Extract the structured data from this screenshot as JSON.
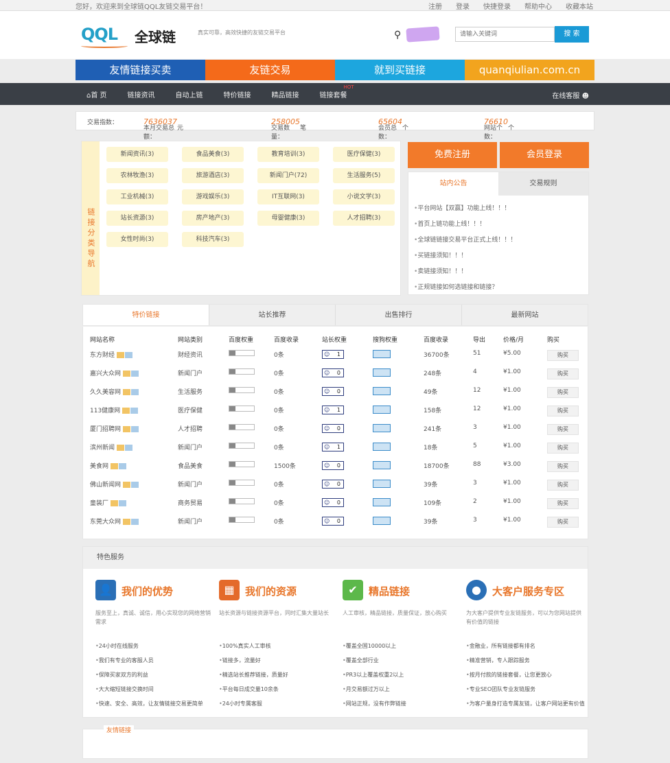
{
  "topbar": {
    "welcome": "您好，欢迎来到全球链QQL友链交易平台！",
    "links": [
      "注册",
      "登录",
      "快捷登录",
      "帮助中心",
      "收藏本站"
    ]
  },
  "header": {
    "logo_text": "QQL",
    "logo_cn": "全球链",
    "slogan": "真实可靠，高效快捷的友链交易平台",
    "search_placeholder": "请输入关键词",
    "search_button": "搜 索"
  },
  "banner": [
    {
      "label": "友情链接买卖",
      "color": "#1f5fb4"
    },
    {
      "label": "友链交易",
      "color": "#f46a1a"
    },
    {
      "label": "就到买链接",
      "color": "#1da6de"
    },
    {
      "label": "quanqiulian.com.cn",
      "color": "#f2a41e"
    }
  ],
  "nav": {
    "items": [
      "首 页",
      "链接资讯",
      "自动上链",
      "特价链接",
      "精品链接",
      "链接套餐"
    ],
    "hot": "HOT",
    "service": "在线客服"
  },
  "stats": {
    "label": "交易指数：",
    "amount_label": "本月交易总额：",
    "amount": "7636037",
    "amount_unit": "元",
    "count_label": "交易数量：",
    "count": "258005",
    "count_unit": "笔",
    "members_label": "会员总数：",
    "members": "65604",
    "members_unit": "个",
    "sites_label": "网站个数：",
    "sites": "76610",
    "sites_unit": "个"
  },
  "categories": {
    "side_label": "链接分类导航",
    "items": [
      "新闻资讯(3)",
      "食品美食(3)",
      "教育培训(3)",
      "医疗保健(3)",
      "农林牧渔(3)",
      "旅游酒店(3)",
      "新闻门户(72)",
      "生活服务(5)",
      "工业机械(3)",
      "游戏娱乐(3)",
      "IT互联网(3)",
      "小说文学(3)",
      "站长资源(3)",
      "房产地产(3)",
      "母婴健康(3)",
      "人才招聘(3)",
      "女性时尚(3)",
      "科技汽车(3)"
    ]
  },
  "register": {
    "free": "免费注册",
    "login": "会员登录"
  },
  "notice": {
    "tabs": [
      "站内公告",
      "交易规则"
    ],
    "items": [
      "平台网站【双赢】功能上线！！！",
      "首页上链功能上线！！！",
      "全球链链接交易平台正式上线！！！",
      "买链接须知！！！",
      "卖链接须知！！！",
      "正规链接如何选链接和链接？"
    ]
  },
  "table": {
    "tabs": [
      "特价链接",
      "站长推荐",
      "出售排行",
      "最新网站"
    ],
    "headers": [
      "网站名称",
      "网站类别",
      "百度权重",
      "百度收录",
      "站长权重",
      "搜狗权重",
      "百度收录",
      "导出",
      "价格/月",
      "购买"
    ],
    "rows": [
      {
        "name": "东方财经",
        "cat": "财经资讯",
        "idx": "0条",
        "pr": "1",
        "baidu": "36700条",
        "out": "51",
        "price": "¥5.00"
      },
      {
        "name": "嘉兴大众网",
        "cat": "新闻门户",
        "idx": "0条",
        "pr": "0",
        "baidu": "248条",
        "out": "4",
        "price": "¥1.00"
      },
      {
        "name": "久久美容网",
        "cat": "生活服务",
        "idx": "0条",
        "pr": "0",
        "baidu": "49条",
        "out": "12",
        "price": "¥1.00"
      },
      {
        "name": "113健康网",
        "cat": "医疗保健",
        "idx": "0条",
        "pr": "1",
        "baidu": "158条",
        "out": "12",
        "price": "¥1.00"
      },
      {
        "name": "厦门招聘网",
        "cat": "人才招聘",
        "idx": "0条",
        "pr": "0",
        "baidu": "241条",
        "out": "3",
        "price": "¥1.00"
      },
      {
        "name": "滨州新闻",
        "cat": "新闻门户",
        "idx": "0条",
        "pr": "1",
        "baidu": "18条",
        "out": "5",
        "price": "¥1.00"
      },
      {
        "name": "美食网",
        "cat": "食品美食",
        "idx": "1500条",
        "pr": "0",
        "baidu": "18700条",
        "out": "88",
        "price": "¥3.00"
      },
      {
        "name": "佛山新闻网",
        "cat": "新闻门户",
        "idx": "0条",
        "pr": "0",
        "baidu": "39条",
        "out": "3",
        "price": "¥1.00"
      },
      {
        "name": "童装厂",
        "cat": "商务贸易",
        "idx": "0条",
        "pr": "0",
        "baidu": "109条",
        "out": "2",
        "price": "¥1.00"
      },
      {
        "name": "东莞大众网",
        "cat": "新闻门户",
        "idx": "0条",
        "pr": "0",
        "baidu": "39条",
        "out": "3",
        "price": "¥1.00"
      }
    ],
    "buy_label": "购买"
  },
  "features": {
    "heading": "特色服务",
    "cols": [
      {
        "title": "我们的优势",
        "color": "#2a6fb6",
        "desc": "服务至上，真诚、诚信，用心实现您的网络营销需求",
        "items": [
          "24小时在线服务",
          "我们有专业的客服人员",
          "保障买家双方的利益",
          "大大缩短链接交换时间",
          "快速、安全、高效，让友情链接交易更简单"
        ]
      },
      {
        "title": "我们的资源",
        "color": "#e46a2a",
        "desc": "站长资源与链接资源平台，同时汇集大量站长",
        "items": [
          "100%真实人工审核",
          "链接多，流量好",
          "精选站长推荐链接，质量好",
          "平台每日成交量10余条",
          "24小时专属客服"
        ]
      },
      {
        "title": "精品链接",
        "color": "#5cb84a",
        "desc": "人工审核，精品链接，质量保证，放心购买",
        "items": [
          "覆盖全国10000以上",
          "覆盖全部行业",
          "PR3以上覆盖权重2以上",
          "月交易额过万以上",
          "网站正规，没有作弊链接"
        ]
      },
      {
        "title": "大客户服务专区",
        "color": "#2a6fb6",
        "desc": "为大客户提供专业友链服务，可以为您网站提供有价值的链接",
        "items": [
          "金融业，所有链接都有排名",
          "精准营销，专人跟踪服务",
          "按月付款的链接套餐，让您更放心",
          "专业SEO团队专业友链服务",
          "为客户量身打造专属友链，让客户网站更有价值"
        ]
      }
    ]
  },
  "friend": {
    "label": "友情链接"
  }
}
